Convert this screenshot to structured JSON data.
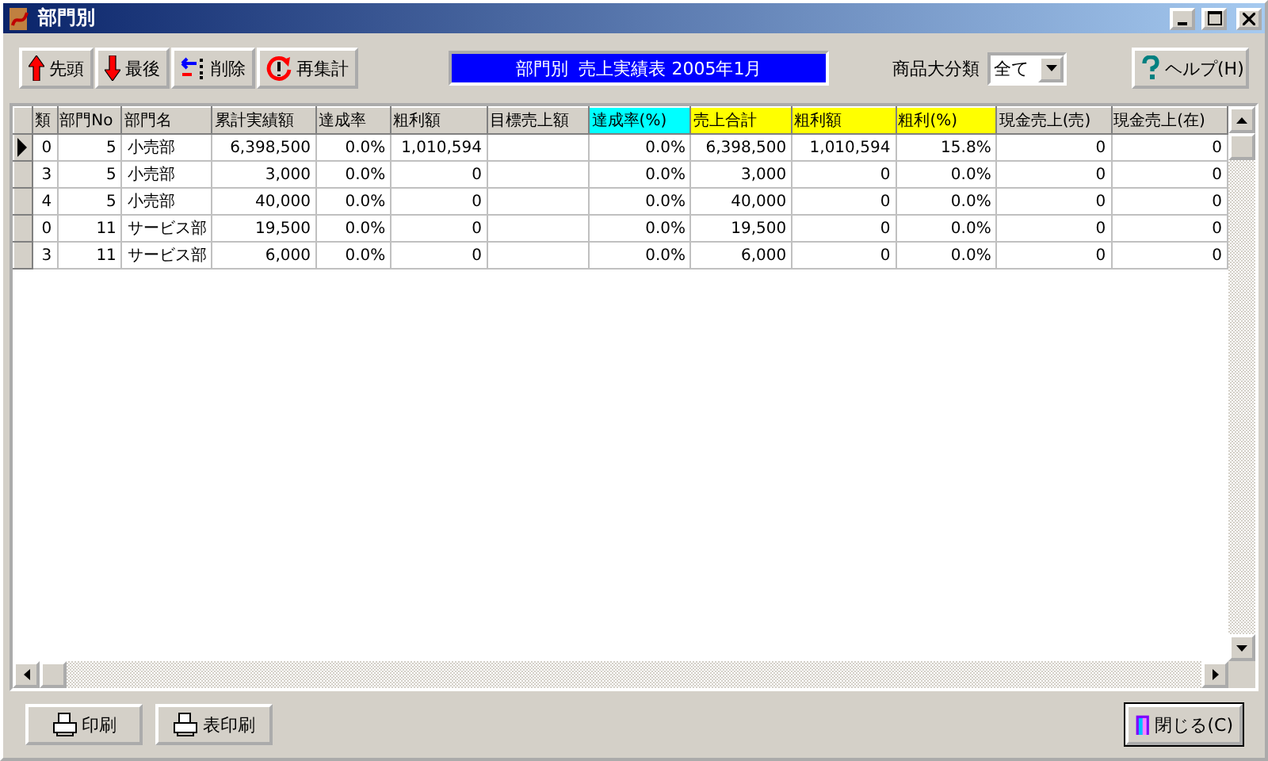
{
  "window": {
    "title": "部門別"
  },
  "toolbar": {
    "buttons": [
      {
        "kind": "up",
        "label": "先頭"
      },
      {
        "kind": "down",
        "label": "最後"
      },
      {
        "kind": "delete",
        "label": "削除"
      },
      {
        "kind": "refresh",
        "label": "再集計"
      }
    ],
    "report_title": "部門別  売上実績表 2005年1月",
    "category_label": "商品大分類",
    "category_value": "全て",
    "help_button": "ヘルプ(H)"
  },
  "table": {
    "columns": [
      {
        "label": "類"
      },
      {
        "label": "部門No"
      },
      {
        "label": "部門名"
      },
      {
        "label": "累計実績額"
      },
      {
        "label": "達成率"
      },
      {
        "label": "粗利額"
      },
      {
        "label": "目標売上額"
      },
      {
        "label": "達成率(%)",
        "color": "#00ffff"
      },
      {
        "label": "売上合計",
        "color": "#ffff00"
      },
      {
        "label": "粗利額",
        "color": "#ffff00"
      },
      {
        "label": "粗利(%)",
        "color": "#ffff00"
      },
      {
        "label": "現金売上(売)"
      },
      {
        "label": "現金売上(在)"
      }
    ],
    "rows": [
      {
        "selected": true,
        "cells": [
          "0",
          "5",
          "小売部",
          "6,398,500",
          "0.0%",
          "1,010,594",
          "",
          "0.0%",
          "6,398,500",
          "1,010,594",
          "15.8%",
          "0",
          "0"
        ]
      },
      {
        "selected": false,
        "cells": [
          "3",
          "5",
          "小売部",
          "3,000",
          "0.0%",
          "0",
          "",
          "0.0%",
          "3,000",
          "0",
          "0.0%",
          "0",
          "0"
        ]
      },
      {
        "selected": false,
        "cells": [
          "4",
          "5",
          "小売部",
          "40,000",
          "0.0%",
          "0",
          "",
          "0.0%",
          "40,000",
          "0",
          "0.0%",
          "0",
          "0"
        ]
      },
      {
        "selected": false,
        "cells": [
          "0",
          "11",
          "サービス部",
          "19,500",
          "0.0%",
          "0",
          "",
          "0.0%",
          "19,500",
          "0",
          "0.0%",
          "0",
          "0"
        ]
      },
      {
        "selected": false,
        "cells": [
          "3",
          "11",
          "サービス部",
          "6,000",
          "0.0%",
          "0",
          "",
          "0.0%",
          "6,000",
          "0",
          "0.0%",
          "0",
          "0"
        ]
      }
    ]
  },
  "footer": {
    "buttons": [
      {
        "kind": "print",
        "label": "印刷"
      },
      {
        "kind": "print",
        "label": "表印刷"
      }
    ],
    "close_button": "閉じる(C)"
  }
}
